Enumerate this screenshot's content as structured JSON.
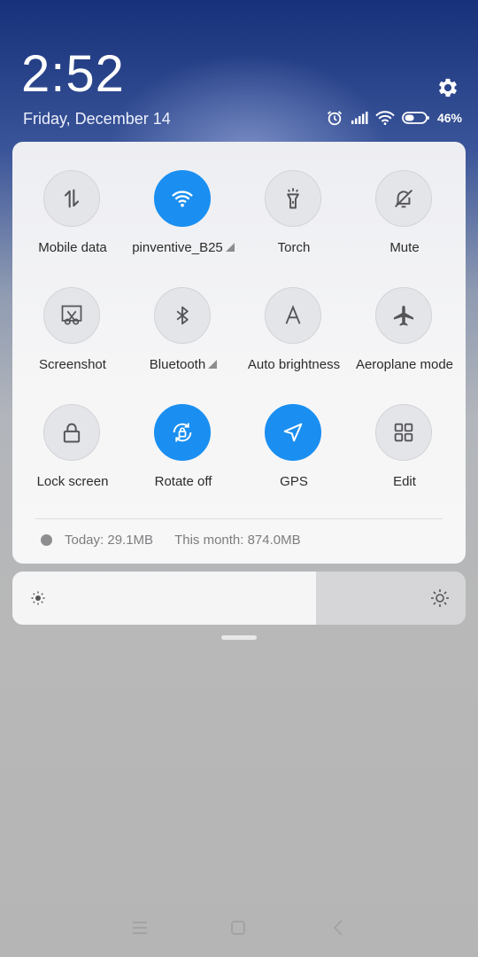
{
  "status": {
    "time": "2:52",
    "date": "Friday, December 14",
    "battery": "46%",
    "battery_level": 0.46,
    "icons": [
      "alarm-icon",
      "signal-icon",
      "wifi-icon",
      "battery-icon"
    ]
  },
  "tiles": [
    {
      "label": "Mobile data",
      "icon": "data-arrows-icon",
      "on": false,
      "arrow": false
    },
    {
      "label": "pinventive_B25",
      "icon": "wifi-icon",
      "on": true,
      "arrow": true
    },
    {
      "label": "Torch",
      "icon": "torch-icon",
      "on": false,
      "arrow": false
    },
    {
      "label": "Mute",
      "icon": "bell-off-icon",
      "on": false,
      "arrow": false
    },
    {
      "label": "Screenshot",
      "icon": "scissors-icon",
      "on": false,
      "arrow": false
    },
    {
      "label": "Bluetooth",
      "icon": "bluetooth-icon",
      "on": false,
      "arrow": true
    },
    {
      "label": "Auto brightness",
      "icon": "auto-brightness-icon",
      "on": false,
      "arrow": false
    },
    {
      "label": "Aeroplane mode",
      "icon": "airplane-icon",
      "on": false,
      "arrow": false
    },
    {
      "label": "Lock screen",
      "icon": "lock-icon",
      "on": false,
      "arrow": false
    },
    {
      "label": "Rotate off",
      "icon": "rotate-lock-icon",
      "on": true,
      "arrow": false
    },
    {
      "label": "GPS",
      "icon": "navigation-icon",
      "on": true,
      "arrow": false
    },
    {
      "label": "Edit",
      "icon": "grid-icon",
      "on": false,
      "arrow": false
    }
  ],
  "usage": {
    "today": "Today: 29.1MB",
    "month": "This month: 874.0MB"
  },
  "brightness": {
    "level": 0.67
  },
  "colors": {
    "accent": "#1a8ff1",
    "tile_off": "#e4e5e8"
  }
}
